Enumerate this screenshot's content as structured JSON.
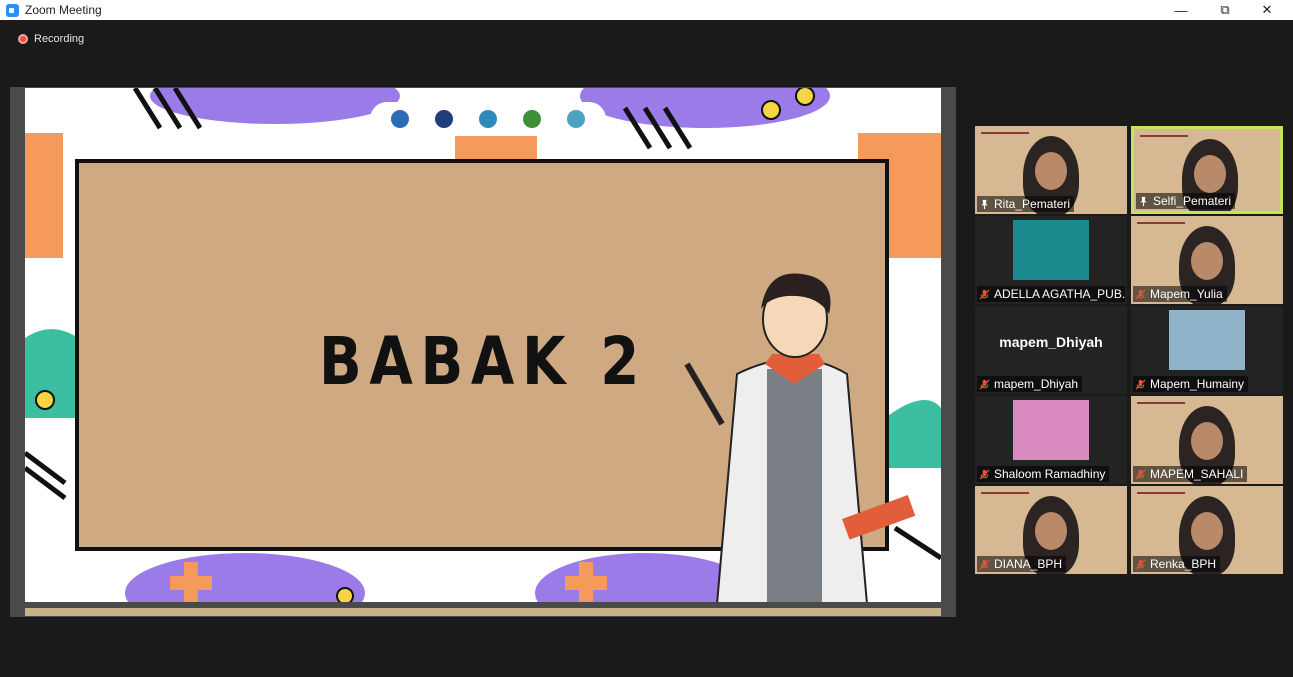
{
  "window": {
    "title": "Zoom Meeting",
    "controls": [
      "minimize-icon",
      "restore-icon",
      "close-icon"
    ]
  },
  "recording": {
    "label": "Recording"
  },
  "slide": {
    "heading": "BABAK 2"
  },
  "participants": [
    {
      "name": "Rita_Pemateri",
      "status": "pinned",
      "video": "slide"
    },
    {
      "name": "Selfi_Pemateri",
      "status": "pinned",
      "video": "slide",
      "active": true
    },
    {
      "name": "ADELLA AGATHA_PUB...",
      "status": "muted",
      "video": "photo"
    },
    {
      "name": "Mapem_Yulia",
      "status": "muted",
      "video": "slide"
    },
    {
      "name": "mapem_Dhiyah",
      "status": "muted",
      "video": "off",
      "display_name": "mapem_Dhiyah"
    },
    {
      "name": "Mapem_Humainy",
      "status": "muted",
      "video": "photo"
    },
    {
      "name": "Shaloom Ramadhiny",
      "status": "muted",
      "video": "photo"
    },
    {
      "name": "MAPEM_SAHALI",
      "status": "muted",
      "video": "slide"
    },
    {
      "name": "DIANA_BPH",
      "status": "muted",
      "video": "slide"
    },
    {
      "name": "Renka_BPH",
      "status": "muted",
      "video": "slide"
    }
  ],
  "colors": {
    "accent": "#2d8cff",
    "active_speaker": "#c4e55b",
    "muted": "#e5533d",
    "board": "#cfa982"
  }
}
